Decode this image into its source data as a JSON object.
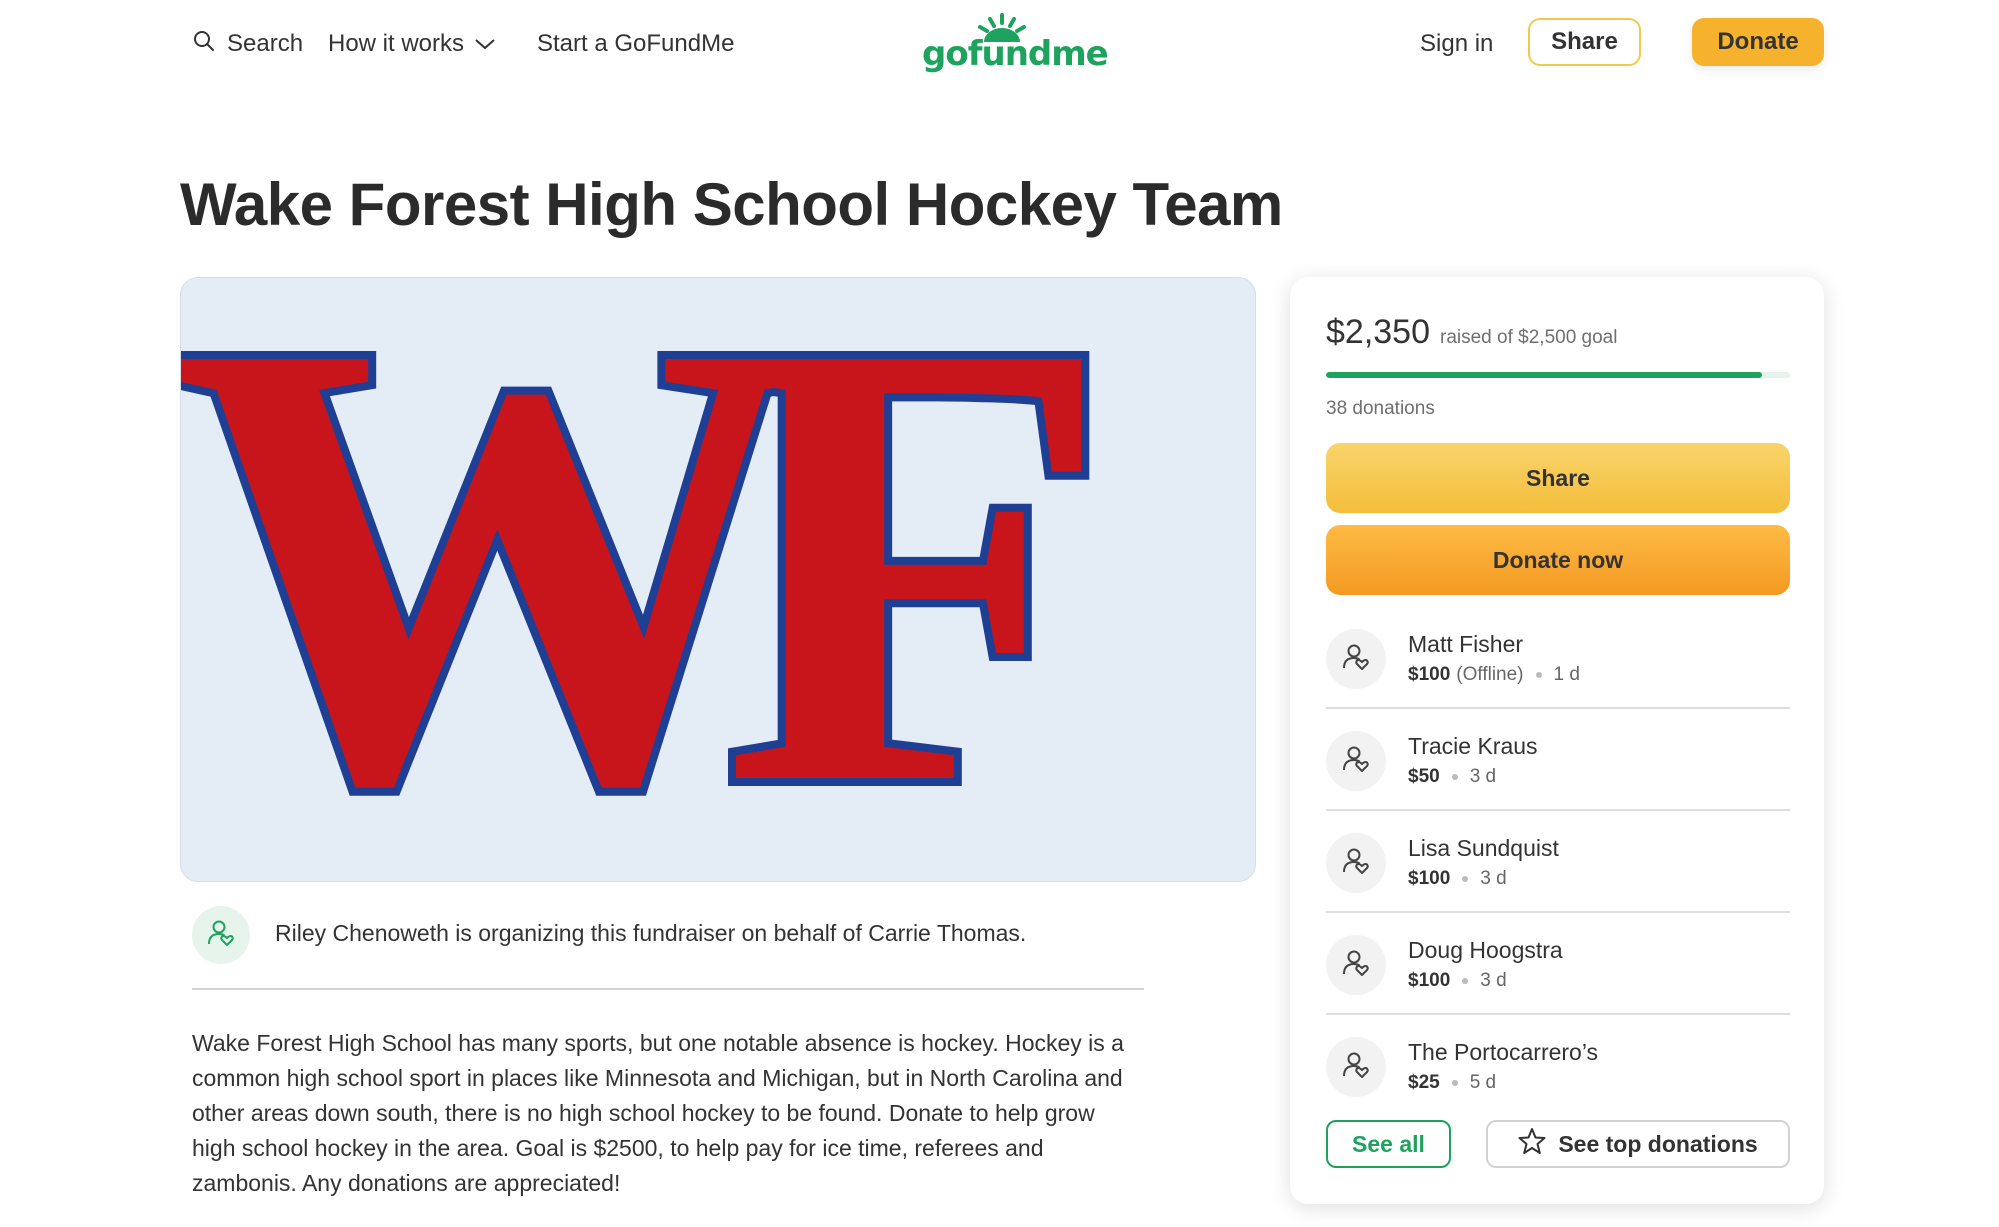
{
  "header": {
    "search_label": "Search",
    "how_it_works_label": "How it works",
    "start_label": "Start a GoFundMe",
    "logo_text": "gofundme",
    "sign_in_label": "Sign in",
    "share_label": "Share",
    "donate_label": "Donate"
  },
  "campaign": {
    "title": "Wake Forest High School Hockey Team",
    "hero_logo_text": "WF",
    "organizer_text": "Riley Chenoweth is organizing this fundraiser on behalf of Carrie Thomas.",
    "story": "Wake Forest High School has many sports, but one notable absence is hockey. Hockey is a common high school sport in places like Minnesota and Michigan, but in North Carolina and other areas down south, there is no high school hockey to be found. Donate to help grow high school hockey in the area. Goal is $2500, to help pay for ice time, referees and zambonis. Any donations are appreciated!"
  },
  "donation_card": {
    "raised": "$2,350",
    "goal_text": "raised of $2,500 goal",
    "progress_fraction": 0.94,
    "donation_count": "38 donations",
    "share_label": "Share",
    "donate_now_label": "Donate now",
    "donations": [
      {
        "name": "Matt Fisher",
        "amount": "$100",
        "note": "(Offline)",
        "time": "1 d"
      },
      {
        "name": "Tracie Kraus",
        "amount": "$50",
        "note": "",
        "time": "3 d"
      },
      {
        "name": "Lisa Sundquist",
        "amount": "$100",
        "note": "",
        "time": "3 d"
      },
      {
        "name": "Doug Hoogstra",
        "amount": "$100",
        "note": "",
        "time": "3 d"
      },
      {
        "name": "The Portocarrero’s",
        "amount": "$25",
        "note": "",
        "time": "5 d"
      }
    ],
    "see_all_label": "See all",
    "see_top_label": "See top donations"
  },
  "colors": {
    "brand_green": "#1ea35f",
    "donate_orange": "#f49a22",
    "share_yellow": "#f4be3b",
    "logo_red": "#c8141b",
    "logo_blue": "#1f3f94"
  },
  "icons": {
    "search": "search-icon",
    "dropdown": "chevron-down-icon",
    "organizer": "person-heart-icon",
    "donor": "person-heart-icon",
    "top_donations": "star-icon"
  }
}
